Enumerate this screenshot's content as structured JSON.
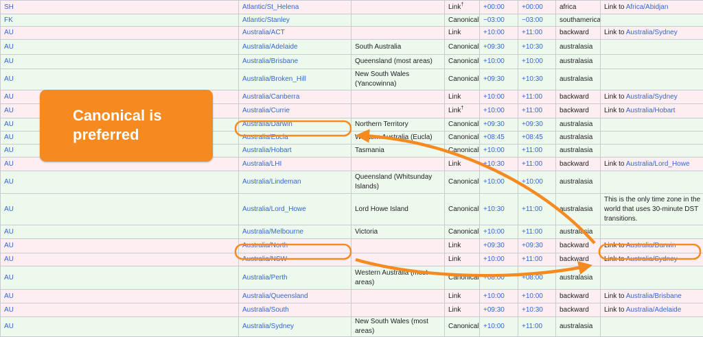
{
  "rows": [
    {
      "cc": "SH",
      "tz": "Atlantic/St_Helena",
      "comment": "",
      "type": "Link",
      "dagger": "†",
      "std": "+00:00",
      "dst": "+00:00",
      "source": "africa",
      "notes_prefix": "Link to ",
      "notes_link": "Africa/Abidjan",
      "notes_text": ""
    },
    {
      "cc": "FK",
      "tz": "Atlantic/Stanley",
      "comment": "",
      "type": "Canonical",
      "dagger": "",
      "std": "−03:00",
      "dst": "−03:00",
      "source": "southamerica",
      "notes_prefix": "",
      "notes_link": "",
      "notes_text": ""
    },
    {
      "cc": "AU",
      "tz": "Australia/ACT",
      "comment": "",
      "type": "Link",
      "dagger": "",
      "std": "+10:00",
      "dst": "+11:00",
      "source": "backward",
      "notes_prefix": "Link to ",
      "notes_link": "Australia/Sydney",
      "notes_text": ""
    },
    {
      "cc": "AU",
      "tz": "Australia/Adelaide",
      "comment": "South Australia",
      "type": "Canonical",
      "dagger": "",
      "std": "+09:30",
      "dst": "+10:30",
      "source": "australasia",
      "notes_prefix": "",
      "notes_link": "",
      "notes_text": ""
    },
    {
      "cc": "AU",
      "tz": "Australia/Brisbane",
      "comment": "Queensland (most areas)",
      "type": "Canonical",
      "dagger": "",
      "std": "+10:00",
      "dst": "+10:00",
      "source": "australasia",
      "notes_prefix": "",
      "notes_link": "",
      "notes_text": ""
    },
    {
      "cc": "AU",
      "tz": "Australia/Broken_Hill",
      "comment": "New South Wales (Yancowinna)",
      "type": "Canonical",
      "dagger": "",
      "std": "+09:30",
      "dst": "+10:30",
      "source": "australasia",
      "notes_prefix": "",
      "notes_link": "",
      "notes_text": ""
    },
    {
      "cc": "AU",
      "tz": "Australia/Canberra",
      "comment": "",
      "type": "Link",
      "dagger": "",
      "std": "+10:00",
      "dst": "+11:00",
      "source": "backward",
      "notes_prefix": "Link to ",
      "notes_link": "Australia/Sydney",
      "notes_text": ""
    },
    {
      "cc": "AU",
      "tz": "Australia/Currie",
      "comment": "",
      "type": "Link",
      "dagger": "†",
      "std": "+10:00",
      "dst": "+11:00",
      "source": "backward",
      "notes_prefix": "Link to ",
      "notes_link": "Australia/Hobart",
      "notes_text": ""
    },
    {
      "cc": "AU",
      "tz": "Australia/Darwin",
      "comment": "Northern Territory",
      "type": "Canonical",
      "dagger": "",
      "std": "+09:30",
      "dst": "+09:30",
      "source": "australasia",
      "notes_prefix": "",
      "notes_link": "",
      "notes_text": ""
    },
    {
      "cc": "AU",
      "tz": "Australia/Eucla",
      "comment": "Western Australia (Eucla)",
      "type": "Canonical",
      "dagger": "",
      "std": "+08:45",
      "dst": "+08:45",
      "source": "australasia",
      "notes_prefix": "",
      "notes_link": "",
      "notes_text": ""
    },
    {
      "cc": "AU",
      "tz": "Australia/Hobart",
      "comment": "Tasmania",
      "type": "Canonical",
      "dagger": "",
      "std": "+10:00",
      "dst": "+11:00",
      "source": "australasia",
      "notes_prefix": "",
      "notes_link": "",
      "notes_text": ""
    },
    {
      "cc": "AU",
      "tz": "Australia/LHI",
      "comment": "",
      "type": "Link",
      "dagger": "",
      "std": "+10:30",
      "dst": "+11:00",
      "source": "backward",
      "notes_prefix": "Link to ",
      "notes_link": "Australia/Lord_Howe",
      "notes_text": ""
    },
    {
      "cc": "AU",
      "tz": "Australia/Lindeman",
      "comment": "Queensland (Whitsunday Islands)",
      "type": "Canonical",
      "dagger": "",
      "std": "+10:00",
      "dst": "+10:00",
      "source": "australasia",
      "notes_prefix": "",
      "notes_link": "",
      "notes_text": ""
    },
    {
      "cc": "AU",
      "tz": "Australia/Lord_Howe",
      "comment": "Lord Howe Island",
      "type": "Canonical",
      "dagger": "",
      "std": "+10:30",
      "dst": "+11:00",
      "source": "australasia",
      "notes_prefix": "",
      "notes_link": "",
      "notes_text": "This is the only time zone in the world that uses 30-minute DST transitions."
    },
    {
      "cc": "AU",
      "tz": "Australia/Melbourne",
      "comment": "Victoria",
      "type": "Canonical",
      "dagger": "",
      "std": "+10:00",
      "dst": "+11:00",
      "source": "australasia",
      "notes_prefix": "",
      "notes_link": "",
      "notes_text": ""
    },
    {
      "cc": "AU",
      "tz": "Australia/North",
      "comment": "",
      "type": "Link",
      "dagger": "",
      "std": "+09:30",
      "dst": "+09:30",
      "source": "backward",
      "notes_prefix": "Link to ",
      "notes_link": "Australia/Darwin",
      "notes_text": ""
    },
    {
      "cc": "AU",
      "tz": "Australia/NSW",
      "comment": "",
      "type": "Link",
      "dagger": "",
      "std": "+10:00",
      "dst": "+11:00",
      "source": "backward",
      "notes_prefix": "Link to ",
      "notes_link": "Australia/Sydney",
      "notes_text": ""
    },
    {
      "cc": "AU",
      "tz": "Australia/Perth",
      "comment": "Western Australia (most areas)",
      "type": "Canonical",
      "dagger": "",
      "std": "+08:00",
      "dst": "+08:00",
      "source": "australasia",
      "notes_prefix": "",
      "notes_link": "",
      "notes_text": ""
    },
    {
      "cc": "AU",
      "tz": "Australia/Queensland",
      "comment": "",
      "type": "Link",
      "dagger": "",
      "std": "+10:00",
      "dst": "+10:00",
      "source": "backward",
      "notes_prefix": "Link to ",
      "notes_link": "Australia/Brisbane",
      "notes_text": ""
    },
    {
      "cc": "AU",
      "tz": "Australia/South",
      "comment": "",
      "type": "Link",
      "dagger": "",
      "std": "+09:30",
      "dst": "+10:30",
      "source": "backward",
      "notes_prefix": "Link to ",
      "notes_link": "Australia/Adelaide",
      "notes_text": ""
    },
    {
      "cc": "AU",
      "tz": "Australia/Sydney",
      "comment": "New South Wales (most areas)",
      "type": "Canonical",
      "dagger": "",
      "std": "+10:00",
      "dst": "+11:00",
      "source": "australasia",
      "notes_prefix": "",
      "notes_link": "",
      "notes_text": ""
    }
  ],
  "callout": {
    "line1": "Canonical is",
    "line2": "preferred"
  },
  "annotation_color": "#f58a21"
}
